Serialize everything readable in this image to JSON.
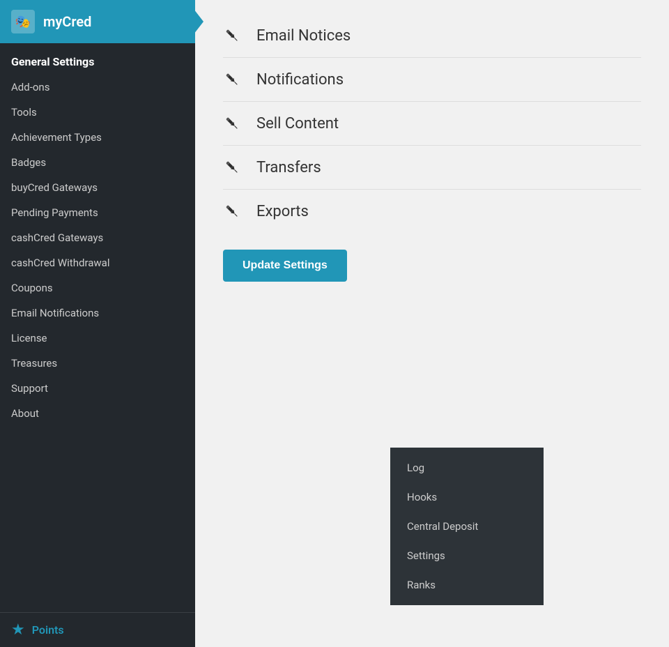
{
  "sidebar": {
    "header": {
      "title": "myCred",
      "logo_icon": "🎭"
    },
    "nav_items": [
      {
        "label": "General Settings",
        "active": true
      },
      {
        "label": "Add-ons",
        "active": false
      },
      {
        "label": "Tools",
        "active": false
      },
      {
        "label": "Achievement Types",
        "active": false
      },
      {
        "label": "Badges",
        "active": false
      },
      {
        "label": "buyCred Gateways",
        "active": false
      },
      {
        "label": "Pending Payments",
        "active": false
      },
      {
        "label": "cashCred Gateways",
        "active": false
      },
      {
        "label": "cashCred Withdrawal",
        "active": false
      },
      {
        "label": "Coupons",
        "active": false
      },
      {
        "label": "Email Notifications",
        "active": false
      },
      {
        "label": "License",
        "active": false
      },
      {
        "label": "Treasures",
        "active": false
      },
      {
        "label": "Support",
        "active": false
      },
      {
        "label": "About",
        "active": false
      }
    ],
    "bottom": {
      "label": "Points",
      "star_icon": "★"
    }
  },
  "main": {
    "menu_items": [
      {
        "label": "Email Notices"
      },
      {
        "label": "Notifications"
      },
      {
        "label": "Sell Content"
      },
      {
        "label": "Transfers"
      },
      {
        "label": "Exports"
      }
    ],
    "update_button_label": "Update Settings"
  },
  "dropdown": {
    "items": [
      {
        "label": "Log"
      },
      {
        "label": "Hooks"
      },
      {
        "label": "Central Deposit"
      },
      {
        "label": "Settings"
      },
      {
        "label": "Ranks"
      }
    ]
  }
}
